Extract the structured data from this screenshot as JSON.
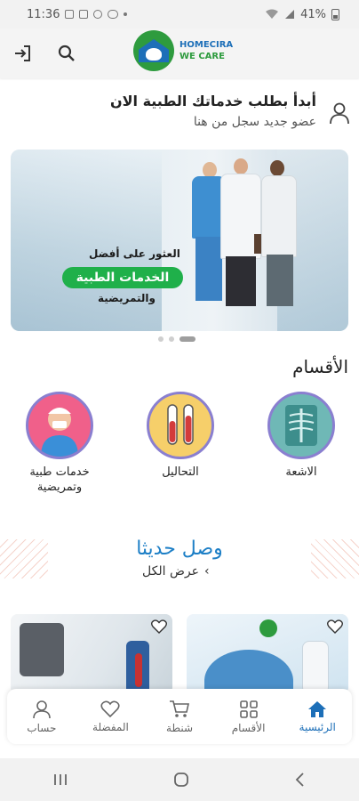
{
  "status_bar": {
    "time": "11:36",
    "battery": "41%"
  },
  "header": {
    "logo_line1": "HOMECIRA",
    "logo_line2": "WE CARE"
  },
  "welcome": {
    "title": "أبدأ بطلب خدماتك الطبية الان",
    "subtitle": "عضو جديد سجل من هنا"
  },
  "banner": {
    "line1": "العثور على أفضل",
    "highlight": "الخدمات الطبية",
    "line3": "والتمريضية"
  },
  "categories": {
    "title": "الأقسام",
    "items": [
      {
        "label": "الاشعة",
        "icon": "xray-icon"
      },
      {
        "label": "التحاليل",
        "icon": "test-tubes-icon"
      },
      {
        "label": "خدمات طبية وتمريضية",
        "icon": "nurse-icon"
      }
    ]
  },
  "recent": {
    "title": "وصل حديثا",
    "view_all": "عرض الكل"
  },
  "bottom_nav": {
    "items": [
      {
        "label": "الرئيسية",
        "icon": "home-icon",
        "active": true
      },
      {
        "label": "الأقسام",
        "icon": "grid-icon",
        "active": false
      },
      {
        "label": "شنطة",
        "icon": "cart-icon",
        "active": false
      },
      {
        "label": "المفضلة",
        "icon": "heart-icon",
        "active": false
      },
      {
        "label": "حساب",
        "icon": "user-icon",
        "active": false
      }
    ]
  },
  "colors": {
    "primary": "#1d6fb8",
    "brand_green": "#2e9b3e",
    "highlight_green": "#1fb04a"
  }
}
